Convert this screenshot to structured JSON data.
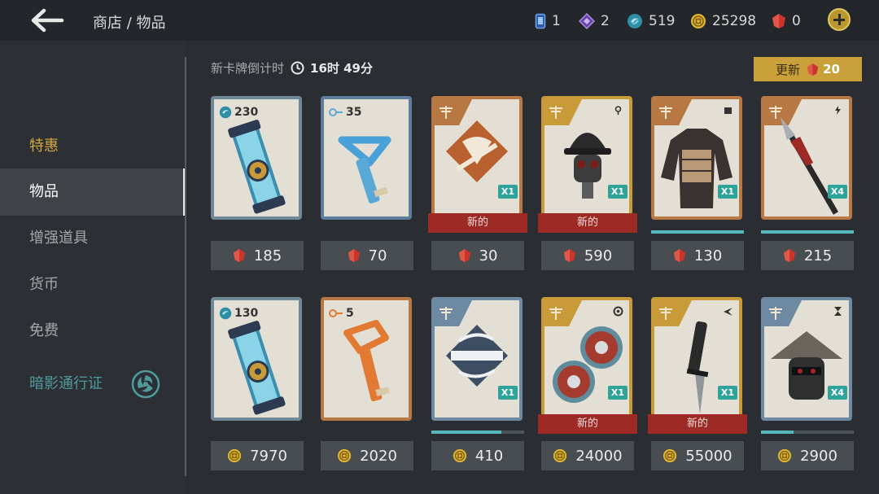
{
  "header": {
    "breadcrumb": "商店 / 物品",
    "currencies": [
      {
        "icon": "blue-card-icon",
        "value": "1"
      },
      {
        "icon": "purple-diamond-icon",
        "value": "2"
      },
      {
        "icon": "teal-orb-icon",
        "value": "519"
      },
      {
        "icon": "gold-coin-icon",
        "value": "25298"
      },
      {
        "icon": "red-gem-icon",
        "value": "0"
      }
    ]
  },
  "sidebar": {
    "items": [
      {
        "label": "特惠"
      },
      {
        "label": "物品"
      },
      {
        "label": "增强道具"
      },
      {
        "label": "货币"
      },
      {
        "label": "免费"
      },
      {
        "label": "暗影通行证"
      }
    ]
  },
  "shop": {
    "timer_label": "新卡牌倒计时",
    "timer_hours": "16时",
    "timer_minutes": "49分",
    "refresh_label": "更新",
    "refresh_cost": "20",
    "new_label": "新的",
    "row1": [
      {
        "item": "orb-capsule",
        "amount": "230",
        "price": "185",
        "currency": "gem"
      },
      {
        "item": "blue-key",
        "amount": "35",
        "price": "70",
        "currency": "gem"
      },
      {
        "item": "shield-emblem",
        "qty": "X1",
        "new": true,
        "price": "30",
        "currency": "gem"
      },
      {
        "item": "spiked-helmet",
        "qty": "X1",
        "new": true,
        "price": "590",
        "currency": "gem"
      },
      {
        "item": "samurai-armor",
        "qty": "X1",
        "progress": 1.0,
        "price": "130",
        "currency": "gem"
      },
      {
        "item": "spear-weapon",
        "qty": "X4",
        "progress": 1.0,
        "price": "215",
        "currency": "gem"
      }
    ],
    "row2": [
      {
        "item": "orb-capsule",
        "amount": "130",
        "price": "7970",
        "currency": "coin"
      },
      {
        "item": "orange-key",
        "amount": "5",
        "price": "2020",
        "currency": "coin"
      },
      {
        "item": "ninja-emblem",
        "qty": "X1",
        "progress": 0.75,
        "price": "410",
        "currency": "coin"
      },
      {
        "item": "shuriken-pair",
        "qty": "X1",
        "new": true,
        "price": "24000",
        "currency": "coin"
      },
      {
        "item": "combat-knife",
        "qty": "X1",
        "new": true,
        "price": "55000",
        "currency": "coin"
      },
      {
        "item": "straw-hat-helmet",
        "qty": "X4",
        "progress": 0.35,
        "price": "2900",
        "currency": "coin"
      }
    ]
  },
  "colors": {
    "gem": "#c9352a",
    "coin": "#e0b52f",
    "new_tag": "#9e2a25",
    "progress": "#56b8ba",
    "active_nav": "#3f4347"
  }
}
